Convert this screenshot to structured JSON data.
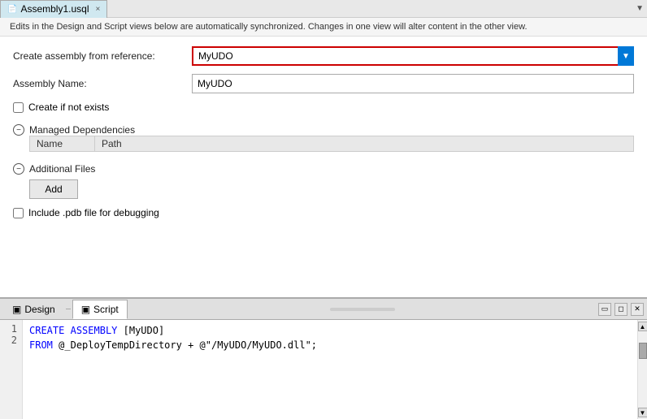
{
  "tab": {
    "label": "Assembly1.usql",
    "icon": "file-icon",
    "close": "×"
  },
  "info_bar": {
    "text": "Edits in the Design and Script views below are automatically synchronized. Changes in one view will alter content in the other view."
  },
  "form": {
    "create_assembly_label": "Create assembly from reference:",
    "create_assembly_value": "MyUDO",
    "assembly_name_label": "Assembly Name:",
    "assembly_name_value": "MyUDO",
    "create_if_not_exists_label": "Create if not exists",
    "managed_dependencies_label": "Managed Dependencies",
    "additional_files_label": "Additional Files",
    "include_pdb_label": "Include .pdb file for debugging",
    "table_col_name": "Name",
    "table_col_path": "Path",
    "add_button": "Add"
  },
  "bottom": {
    "design_tab": "Design",
    "script_tab": "Script",
    "scroll_tab": "——",
    "icon1": "□",
    "icon2": "□",
    "icon3": "□"
  },
  "code": {
    "lines": [
      {
        "num": "1",
        "content_parts": [
          {
            "text": "CREATE",
            "class": "kw"
          },
          {
            "text": " ASSEMBLY ",
            "class": "kw"
          },
          {
            "text": "[MyUDO]",
            "class": ""
          }
        ]
      },
      {
        "num": "2",
        "content_parts": [
          {
            "text": "FROM",
            "class": "kw"
          },
          {
            "text": " @_DeployTempDirectory + @\"/MyUDO/MyUDO.dll\";",
            "class": ""
          }
        ]
      }
    ]
  }
}
